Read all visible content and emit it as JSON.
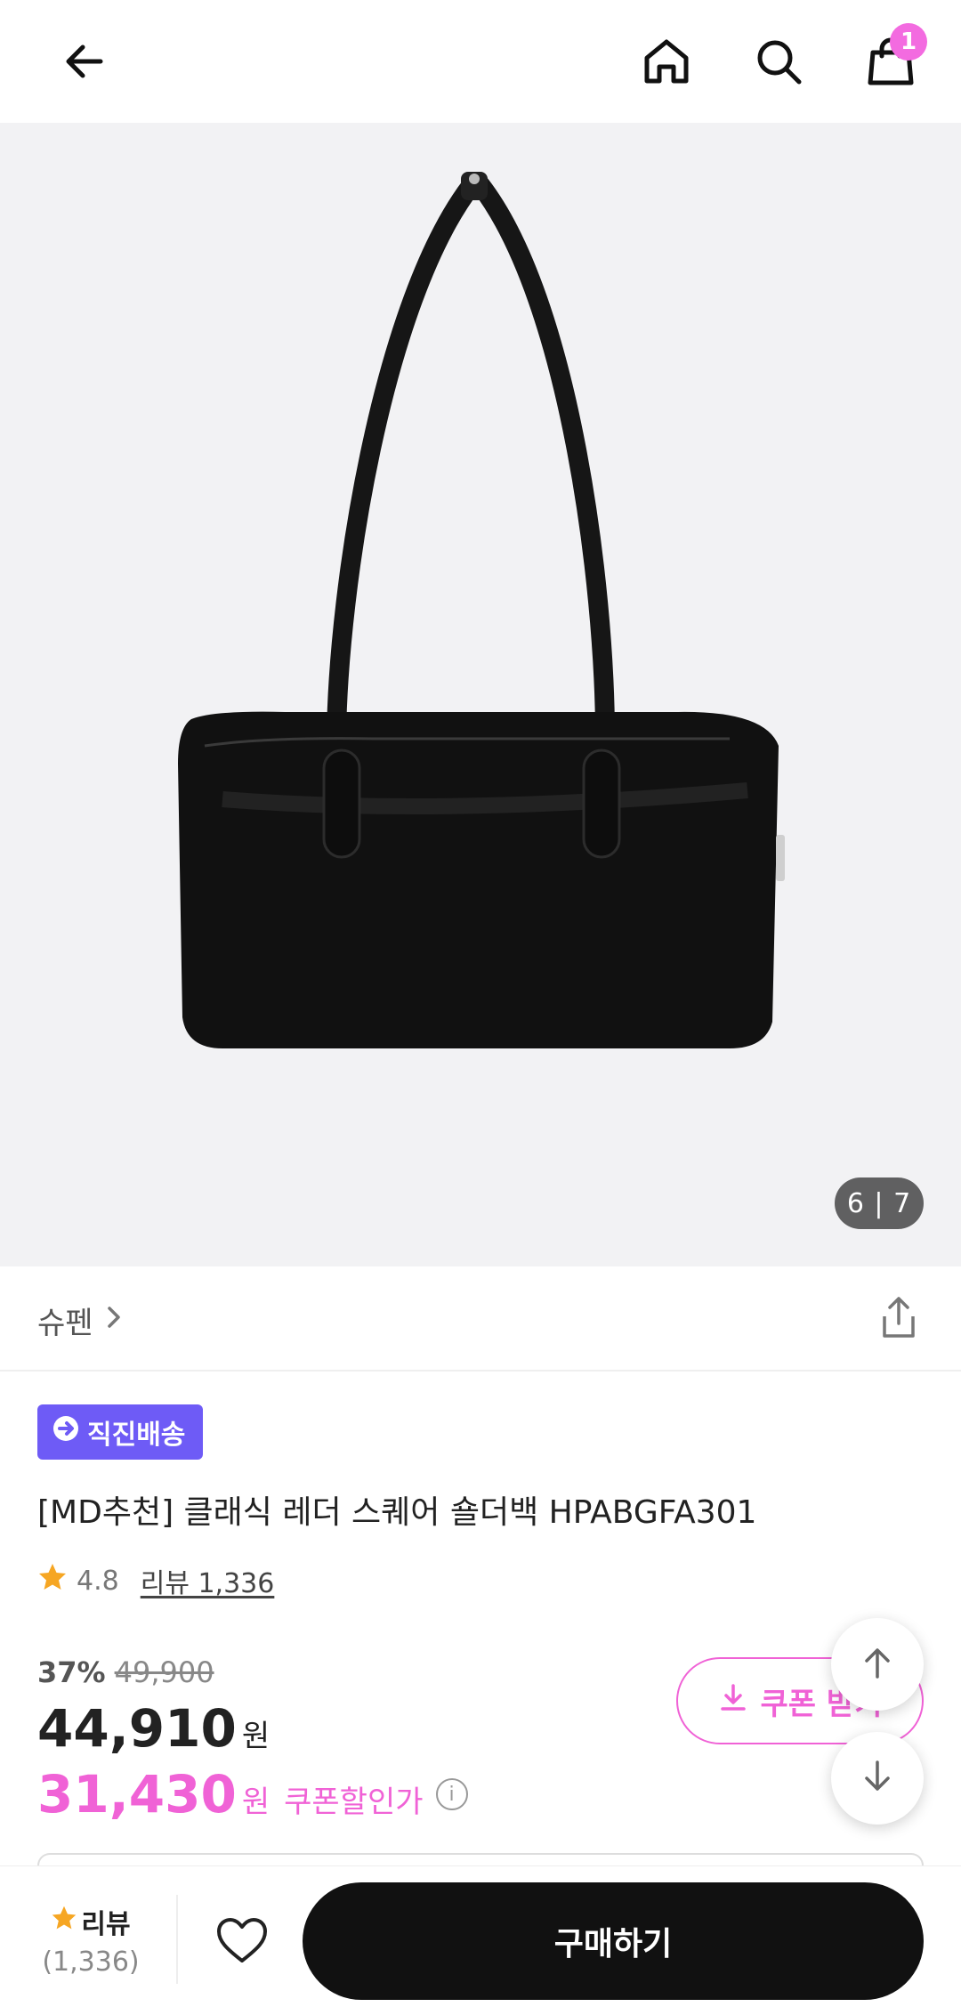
{
  "header": {
    "cart_count": "1",
    "icons": [
      "back-arrow-icon",
      "home-icon",
      "search-icon",
      "shopping-bag-icon"
    ]
  },
  "hero": {
    "image_counter": "6 | 7"
  },
  "brand": {
    "name": "슈펜",
    "share_icon": "share-icon"
  },
  "product": {
    "delivery_badge": "직진배송",
    "title": "[MD추천] 클래식 레더 스퀘어 숄더백 HPABGFA301",
    "rating": "4.8",
    "review_label": "리뷰 1,336"
  },
  "price": {
    "discount_rate": "37%",
    "original_price": "49,900",
    "sale_price": "44,910",
    "won": "원",
    "coupon_price": "31,430",
    "coupon_label": "쿠폰할인가"
  },
  "coupon_button": {
    "label": "쿠폰 받기"
  },
  "bottom_bar": {
    "review_label": "리뷰",
    "review_count": "(1,336)",
    "buy_label": "구매하기"
  },
  "colors": {
    "accent_pink": "#f062d6",
    "badge_purple": "#6e5bf6",
    "buy_black": "#111111"
  }
}
